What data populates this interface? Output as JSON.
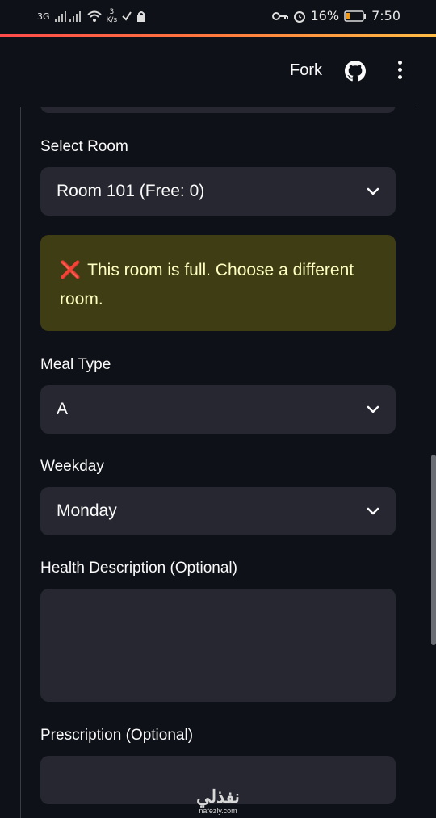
{
  "statusbar": {
    "network": "3G",
    "speed": "3\nK/s",
    "battery": "16%",
    "time": "7:50"
  },
  "header": {
    "fork_label": "Fork"
  },
  "form": {
    "room": {
      "label": "Select Room",
      "value": "Room 101 (Free: 0)"
    },
    "alert": {
      "icon": "❌",
      "message": "This room is full. Choose a different room.",
      "color": "#3e3d13"
    },
    "meal": {
      "label": "Meal Type",
      "value": "A"
    },
    "weekday": {
      "label": "Weekday",
      "value": "Monday"
    },
    "health": {
      "label": "Health Description (Optional)",
      "value": ""
    },
    "prescription": {
      "label": "Prescription (Optional)",
      "value": ""
    }
  },
  "watermark": {
    "arabic": "نفذلي",
    "latin": "nafezly.com"
  },
  "colors": {
    "background": "#0e1117",
    "input_bg": "#262730",
    "accent_start": "#ff4b4b",
    "accent_end": "#ffbd45"
  }
}
